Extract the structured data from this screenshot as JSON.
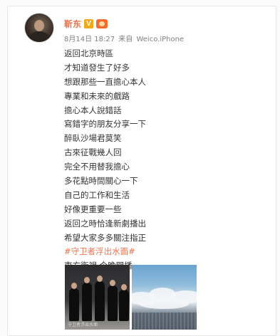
{
  "post": {
    "author": "靳东",
    "verified_badge": "V",
    "time": "8月14日 18:27",
    "source_prefix": "来自",
    "source": "Weico.iPhone",
    "lines": [
      "返回北京時區",
      "才知道發生了好多",
      "想跟那些一直擔心本人",
      "專業和未來的戲路",
      "擔心本人說錯話",
      "寫錯字的朋友分享一下",
      "醉臥沙場君莫笑",
      "古來征戰幾人回",
      "完全不用替我擔心",
      "多花點時間關心一下",
      "自己的工作和生活",
      "好像更重要一些",
      "返回之時恰逢新劇播出",
      "希望大家多多關注指正"
    ],
    "hashtag": "#守卫者浮出水面#",
    "last_line": "東方衛視 今晚開播",
    "photo_caption": "守卫者浮出水面"
  },
  "colors": {
    "accent": "#eb7350",
    "text": "#333333",
    "meta": "#808080",
    "verified": "#f2a81b"
  },
  "icons": {
    "verified": "verified-v-icon",
    "member": "member-crown-icon"
  }
}
